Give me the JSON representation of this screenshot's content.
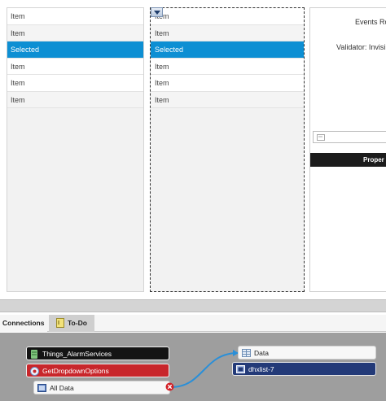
{
  "left_list": {
    "items": [
      {
        "label": "Item",
        "selected": false
      },
      {
        "label": "Item",
        "selected": false
      },
      {
        "label": "Selected",
        "selected": true
      },
      {
        "label": "Item",
        "selected": false
      },
      {
        "label": "Item",
        "selected": false
      },
      {
        "label": "Item",
        "selected": false
      }
    ]
  },
  "right_list": {
    "items": [
      {
        "label": "Item",
        "selected": false
      },
      {
        "label": "Item",
        "selected": false
      },
      {
        "label": "Selected",
        "selected": true
      },
      {
        "label": "Item",
        "selected": false
      },
      {
        "label": "Item",
        "selected": false
      },
      {
        "label": "Item",
        "selected": false
      }
    ]
  },
  "properties": {
    "title": "Events Ro",
    "validator": "Validator: Invisi",
    "header": "Proper"
  },
  "tabs": {
    "connections": "Connections",
    "todo": "To-Do"
  },
  "canvas": {
    "nodes": {
      "alarm_services": "Things_AlarmServices",
      "get_dropdown_options": "GetDropdownOptions",
      "all_data": "All Data",
      "data": "Data",
      "dhxlist": "dhxlist-7"
    }
  },
  "colors": {
    "selected_row": "#0d8fd3",
    "service_node": "#141414",
    "service_node_error": "#c8262b",
    "widget_node": "#233a78",
    "connection_wire": "#2a8fd8",
    "canvas_bg": "#9e9e9e"
  }
}
